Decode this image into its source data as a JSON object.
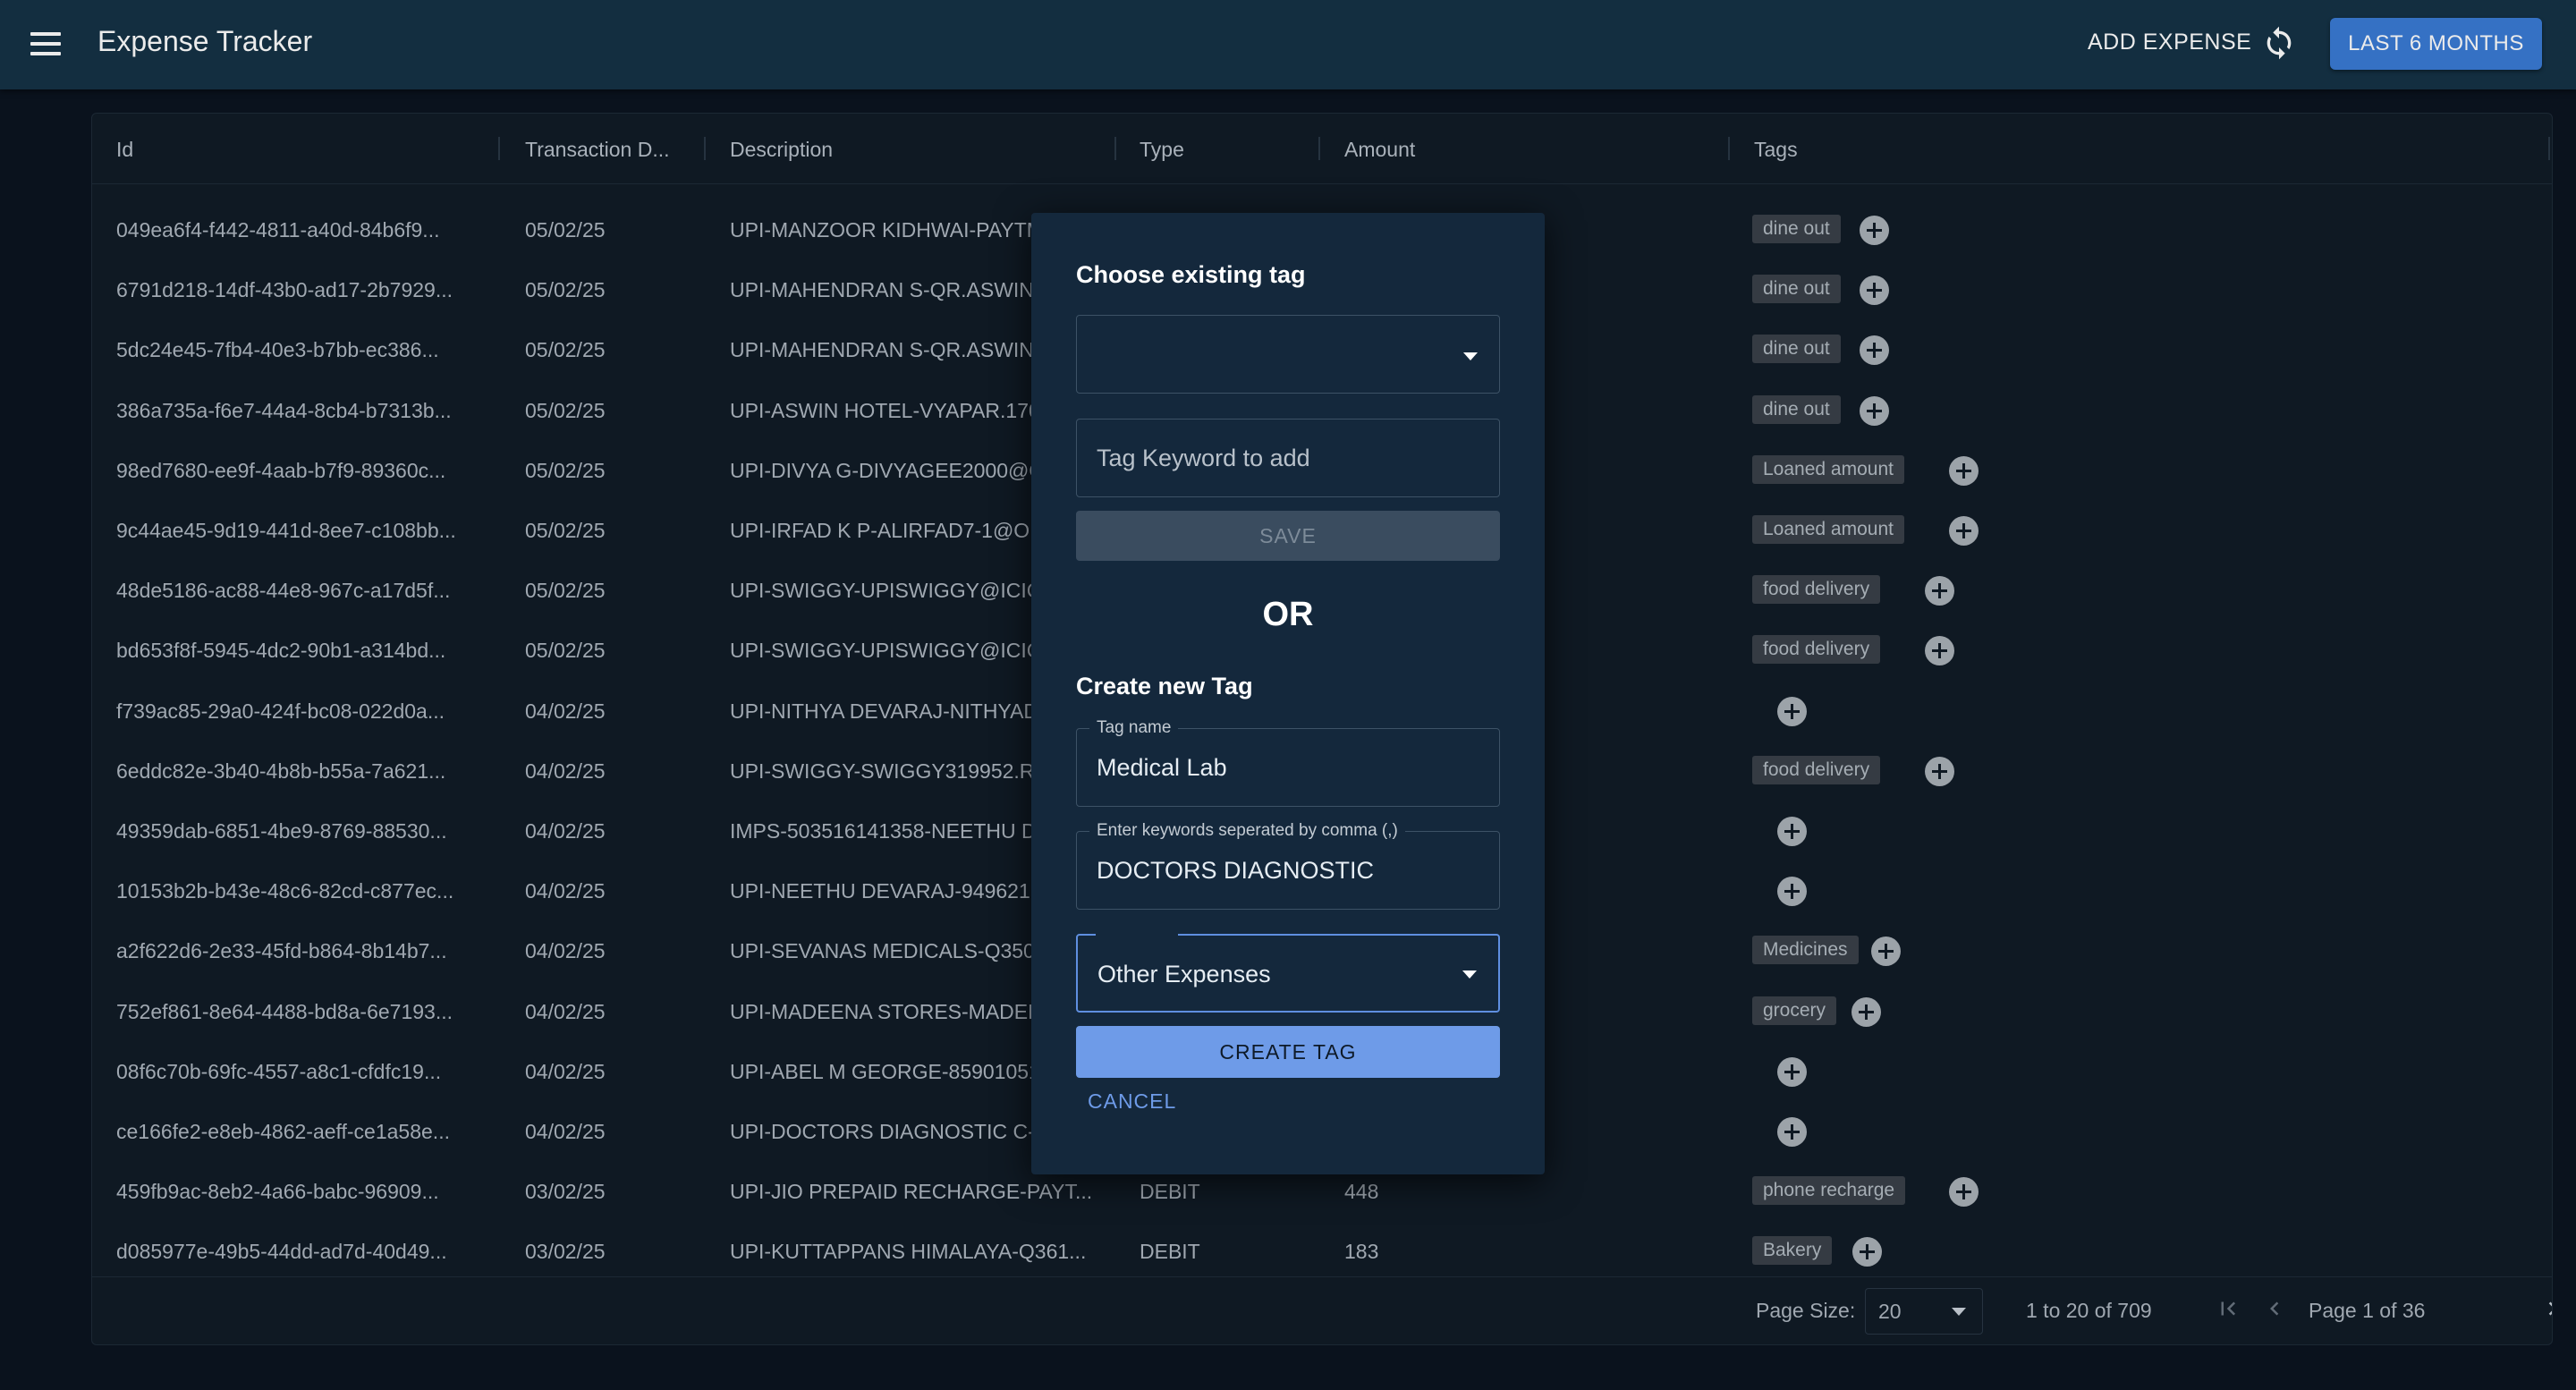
{
  "app": {
    "title": "Expense Tracker",
    "add_expense_label": "ADD EXPENSE",
    "range_button_label": "LAST 6 MONTHS"
  },
  "table": {
    "columns": [
      "Id",
      "Transaction D...",
      "Description",
      "Type",
      "Amount",
      "Tags"
    ],
    "rows": [
      {
        "id": "049ea6f4-f442-4811-a40d-84b6f9...",
        "date": "05/02/25",
        "description": "UPI-MANZOOR KIDHWAI-PAYTM",
        "type": "",
        "amount": "",
        "tag": "dine out"
      },
      {
        "id": "6791d218-14df-43b0-ad17-2b7929...",
        "date": "05/02/25",
        "description": "UPI-MAHENDRAN S-QR.ASWINI",
        "type": "",
        "amount": "",
        "tag": "dine out"
      },
      {
        "id": "5dc24e45-7fb4-40e3-b7bb-ec386...",
        "date": "05/02/25",
        "description": "UPI-MAHENDRAN S-QR.ASWINI",
        "type": "",
        "amount": "",
        "tag": "dine out"
      },
      {
        "id": "386a735a-f6e7-44a4-8cb4-b7313b...",
        "date": "05/02/25",
        "description": "UPI-ASWIN HOTEL-VYAPAR.170",
        "type": "",
        "amount": "",
        "tag": "dine out"
      },
      {
        "id": "98ed7680-ee9f-4aab-b7f9-89360c...",
        "date": "05/02/25",
        "description": "UPI-DIVYA G-DIVYAGEE2000@O",
        "type": "",
        "amount": "",
        "tag": "Loaned amount"
      },
      {
        "id": "9c44ae45-9d19-441d-8ee7-c108bb...",
        "date": "05/02/25",
        "description": "UPI-IRFAD K P-ALIRFAD7-1@OK",
        "type": "",
        "amount": "",
        "tag": "Loaned amount"
      },
      {
        "id": "48de5186-ac88-44e8-967c-a17d5f...",
        "date": "05/02/25",
        "description": "UPI-SWIGGY-UPISWIGGY@ICIC",
        "type": "",
        "amount": "",
        "tag": "food delivery"
      },
      {
        "id": "bd653f8f-5945-4dc2-90b1-a314bd...",
        "date": "05/02/25",
        "description": "UPI-SWIGGY-UPISWIGGY@ICIC",
        "type": "",
        "amount": "",
        "tag": "food delivery"
      },
      {
        "id": "f739ac85-29a0-424f-bc08-022d0a...",
        "date": "04/02/25",
        "description": "UPI-NITHYA DEVARAJ-NITHYAD",
        "type": "",
        "amount": "",
        "tag": ""
      },
      {
        "id": "6eddc82e-3b40-4b8b-b55a-7a621...",
        "date": "04/02/25",
        "description": "UPI-SWIGGY-SWIGGY319952.R",
        "type": "",
        "amount": "",
        "tag": "food delivery"
      },
      {
        "id": "49359dab-6851-4be9-8769-88530...",
        "date": "04/02/25",
        "description": "IMPS-503516141358-NEETHU D",
        "type": "",
        "amount": "",
        "tag": ""
      },
      {
        "id": "10153b2b-b43e-48c6-82cd-c877ec...",
        "date": "04/02/25",
        "description": "UPI-NEETHU DEVARAJ-949621",
        "type": "",
        "amount": "",
        "tag": ""
      },
      {
        "id": "a2f622d6-2e33-45fd-b864-8b14b7...",
        "date": "04/02/25",
        "description": "UPI-SEVANAS MEDICALS-Q350",
        "type": "",
        "amount": "",
        "tag": "Medicines"
      },
      {
        "id": "752ef861-8e64-4488-bd8a-6e7193...",
        "date": "04/02/25",
        "description": "UPI-MADEENA STORES-MADEE",
        "type": "",
        "amount": "",
        "tag": "grocery"
      },
      {
        "id": "08f6c70b-69fc-4557-a8c1-cfdfc19...",
        "date": "04/02/25",
        "description": "UPI-ABEL M GEORGE-85901051",
        "type": "",
        "amount": "",
        "tag": ""
      },
      {
        "id": "ce166fe2-e8eb-4862-aeff-ce1a58e...",
        "date": "04/02/25",
        "description": "UPI-DOCTORS DIAGNOSTIC C-/",
        "type": "",
        "amount": "",
        "tag": ""
      },
      {
        "id": "459fb9ac-8eb2-4a66-babc-96909...",
        "date": "03/02/25",
        "description": "UPI-JIO PREPAID RECHARGE-PAYT...",
        "type": "DEBIT",
        "amount": "448",
        "tag": "phone recharge"
      },
      {
        "id": "d085977e-49b5-44dd-ad7d-40d49...",
        "date": "03/02/25",
        "description": "UPI-KUTTAPPANS HIMALAYA-Q361...",
        "type": "DEBIT",
        "amount": "183",
        "tag": "Bakery"
      }
    ]
  },
  "pagination": {
    "page_size_label": "Page Size:",
    "page_size_value": "20",
    "range_text": "1 to 20 of 709",
    "page_text": "Page 1 of 36"
  },
  "dialog": {
    "choose_title": "Choose existing tag",
    "existing_tag_value": "",
    "keyword_placeholder": "Tag Keyword to add",
    "save_label": "SAVE",
    "or_text": "OR",
    "create_title": "Create new Tag",
    "tag_name_label": "Tag name",
    "tag_name_value": "Medical Lab",
    "keywords_label": "Enter keywords seperated by comma (,)",
    "keywords_value": "DOCTORS DIAGNOSTIC",
    "category_value": "Other Expenses",
    "create_label": "CREATE TAG",
    "cancel_label": "CANCEL"
  },
  "icons": {
    "menu": "menu-icon",
    "refresh": "refresh-icon",
    "add_tag": "plus-circle-icon",
    "dropdown": "caret-down-icon",
    "first": "first-page-icon",
    "prev": "chevron-left-icon",
    "next": "chevron-right-icon",
    "last": "last-page-icon"
  },
  "colors": {
    "appbar": "#153246",
    "accent": "#3a7bd5",
    "primary_button": "#6e9be8",
    "background": "#0b1420",
    "dialog": "#14283c"
  }
}
